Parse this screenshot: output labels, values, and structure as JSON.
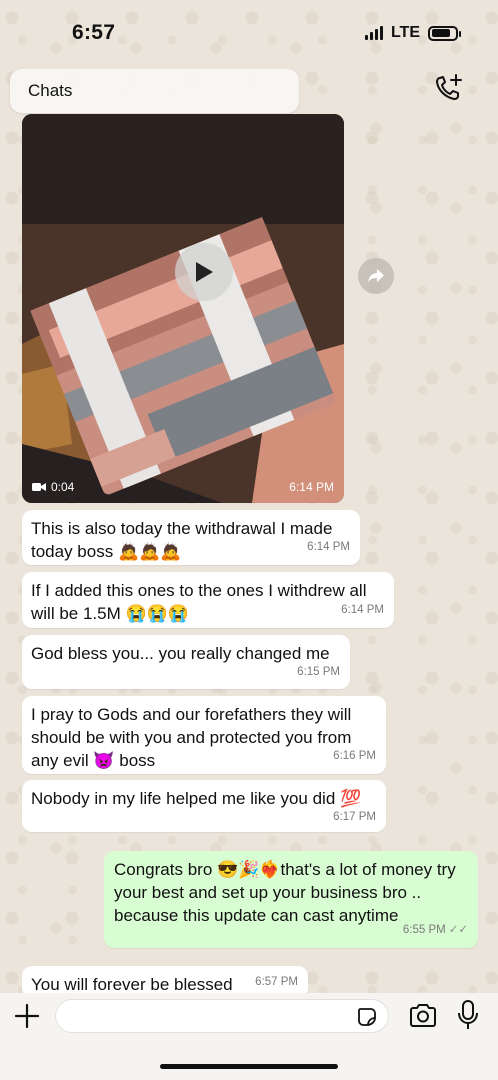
{
  "status_bar": {
    "time": "6:57",
    "network": "LTE"
  },
  "header": {
    "back_label": "Chats"
  },
  "video_message": {
    "duration": "0:04",
    "time": "6:14 PM"
  },
  "messages": [
    {
      "text": "This is also today the withdrawal I made today boss 🙇🙇🙇",
      "time": "6:14 PM"
    },
    {
      "text": "If I added this ones to the ones I withdrew all will be 1.5M 😭😭😭",
      "time": "6:14 PM"
    },
    {
      "text": "God bless you... you really changed me",
      "time": "6:15 PM"
    },
    {
      "text": "I pray to Gods and our forefathers they will should be with you and protected you from any evil 👿 boss",
      "time": "6:16 PM"
    },
    {
      "text": "Nobody in my life helped me like you did 💯",
      "time": "6:17 PM"
    },
    {
      "text": "Congrats bro 😎🎉❤️‍🔥that's a lot of money try your best and set up your business bro .. because this update can cast anytime",
      "time": "6:55 PM"
    },
    {
      "text": "You will forever be blessed",
      "time": "6:57 PM"
    }
  ],
  "colors": {
    "incoming": "#ffffff",
    "outgoing": "#d9fdd3",
    "wallpaper": "#ebe4da"
  }
}
